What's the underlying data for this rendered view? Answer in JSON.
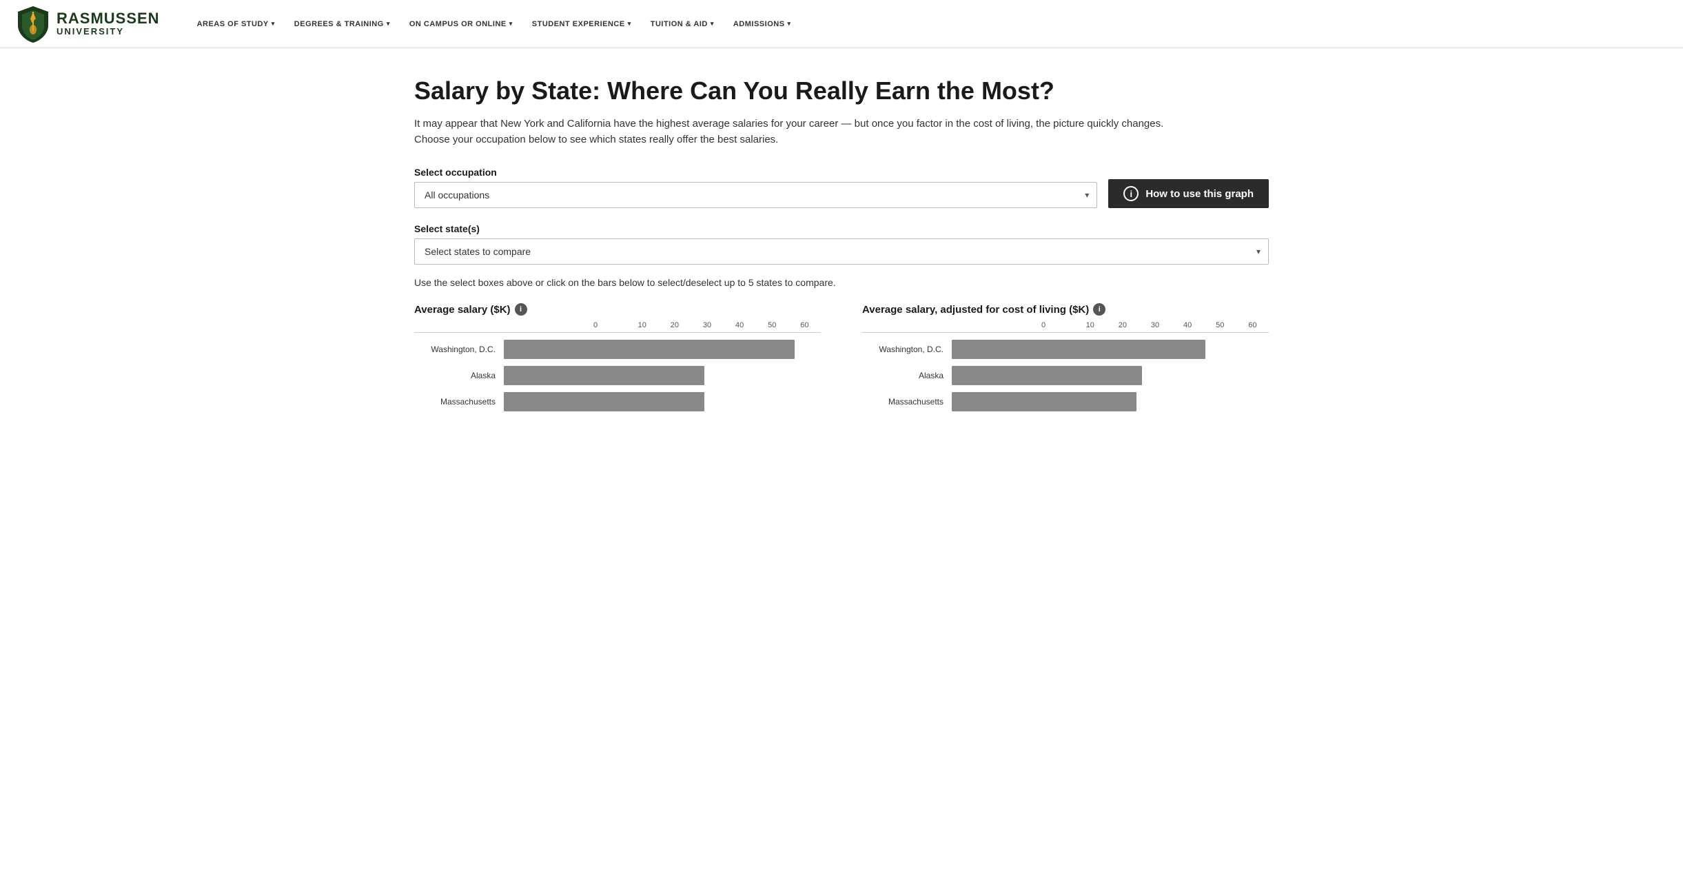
{
  "nav": {
    "logo": {
      "rasmussen": "RASMUSSEN",
      "university": "UNIVERSITY"
    },
    "links": [
      {
        "label": "AREAS OF STUDY",
        "id": "areas-of-study"
      },
      {
        "label": "DEGREES & TRAINING",
        "id": "degrees-training"
      },
      {
        "label": "ON CAMPUS OR ONLINE",
        "id": "on-campus-online"
      },
      {
        "label": "STUDENT EXPERIENCE",
        "id": "student-experience"
      },
      {
        "label": "TUITION & AID",
        "id": "tuition-aid"
      },
      {
        "label": "ADMISSIONS",
        "id": "admissions"
      }
    ]
  },
  "page": {
    "title": "Salary by State: Where Can You Really Earn the Most?",
    "description": "It may appear that New York and California have the highest average salaries for your career — but once you factor in the cost of living, the picture quickly changes. Choose your occupation below to see which states really offer the best salaries.",
    "occupation_label": "Select occupation",
    "occupation_placeholder": "All occupations",
    "state_label": "Select state(s)",
    "state_placeholder": "Select states to compare",
    "how_to_label": "How to use this graph",
    "hint_text": "Use the select boxes above or click on the bars below to select/deselect up to 5 states to compare."
  },
  "charts": {
    "left": {
      "title": "Average salary ($K)",
      "axis_ticks": [
        "0",
        "10",
        "20",
        "30",
        "40",
        "50",
        "60"
      ],
      "max_value": 60,
      "bars": [
        {
          "state": "Washington, D.C.",
          "value": 55
        },
        {
          "state": "Alaska",
          "value": 38
        },
        {
          "state": "Massachusetts",
          "value": 38
        }
      ]
    },
    "right": {
      "title": "Average salary, adjusted for cost of living ($K)",
      "axis_ticks": [
        "0",
        "10",
        "20",
        "30",
        "40",
        "50",
        "60"
      ],
      "max_value": 60,
      "bars": [
        {
          "state": "Washington, D.C.",
          "value": 48
        },
        {
          "state": "Alaska",
          "value": 36
        },
        {
          "state": "Massachusetts",
          "value": 35
        }
      ]
    }
  }
}
